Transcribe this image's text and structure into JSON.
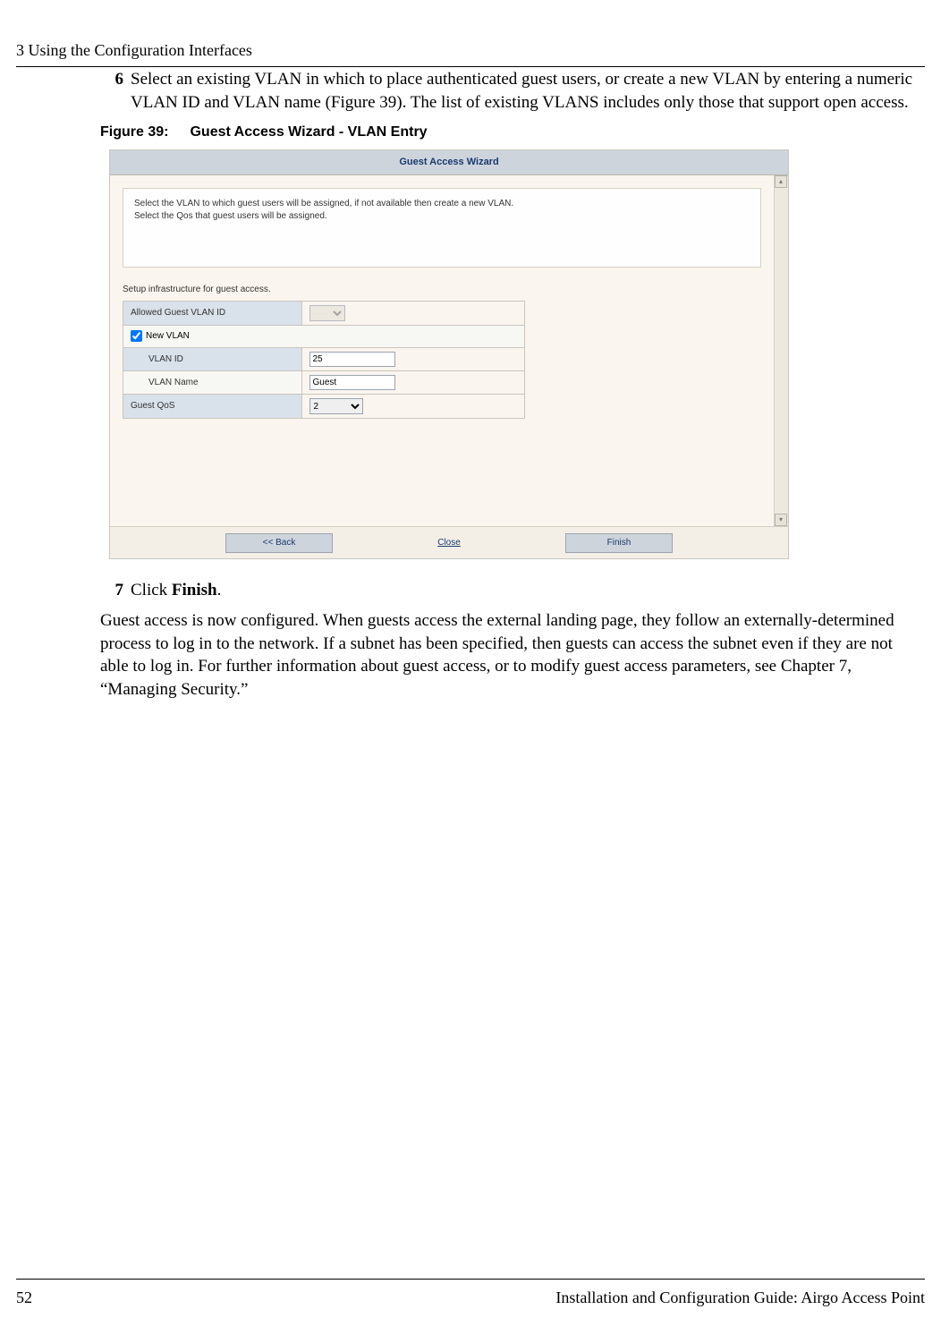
{
  "header": {
    "chapter": "3  Using the Configuration Interfaces"
  },
  "step6": {
    "num": "6",
    "text": "Select an existing VLAN in which to place authenticated guest users, or create a new VLAN by entering a numeric VLAN ID and VLAN name (Figure 39). The list of existing VLANS includes only those that support open access."
  },
  "figcaption": {
    "num": "Figure 39:",
    "title": "Guest Access Wizard - VLAN Entry"
  },
  "wizard": {
    "title": "Guest Access Wizard",
    "instr1": "Select the VLAN to which guest users will be assigned, if not available then create a new VLAN.",
    "instr2": "Select the Qos that guest users will be assigned.",
    "section": "Setup infrastructure for guest access.",
    "rows": {
      "allowed": "Allowed Guest VLAN ID",
      "newvlan": "New VLAN",
      "vlanid": "VLAN ID",
      "vlanname": "VLAN Name",
      "qos": "Guest QoS"
    },
    "values": {
      "vlanid": "25",
      "vlanname": "Guest",
      "qos": "2"
    },
    "buttons": {
      "back": "<< Back",
      "close": "Close",
      "finish": "Finish"
    }
  },
  "step7": {
    "num": "7",
    "pre": "Click ",
    "bold": "Finish",
    "post": "."
  },
  "para": "Guest access is now configured. When guests access the external landing page, they follow an externally-determined process to log in to the network. If a subnet has been specified, then guests can access the subnet even if they are not able to log in. For further information about guest access, or to modify guest access parameters, see Chapter 7,  “Managing Security.”",
  "footer": {
    "page": "52",
    "title": "Installation and Configuration Guide: Airgo Access Point"
  }
}
